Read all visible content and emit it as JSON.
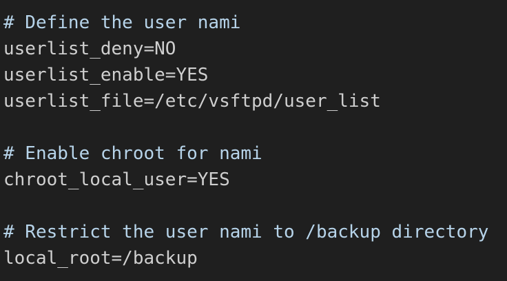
{
  "colors": {
    "background": "#1f1f1f",
    "comment": "#b7d4ea",
    "code": "#cfcfcf"
  },
  "lines": [
    {
      "type": "comment",
      "text": "# Define the user nami"
    },
    {
      "type": "code",
      "text": "userlist_deny=NO"
    },
    {
      "type": "code",
      "text": "userlist_enable=YES"
    },
    {
      "type": "code",
      "text": "userlist_file=/etc/vsftpd/user_list"
    },
    {
      "type": "blank",
      "text": ""
    },
    {
      "type": "comment",
      "text": "# Enable chroot for nami"
    },
    {
      "type": "code",
      "text": "chroot_local_user=YES"
    },
    {
      "type": "blank",
      "text": ""
    },
    {
      "type": "comment",
      "text": "# Restrict the user nami to /backup directory"
    },
    {
      "type": "code",
      "text": "local_root=/backup"
    }
  ]
}
